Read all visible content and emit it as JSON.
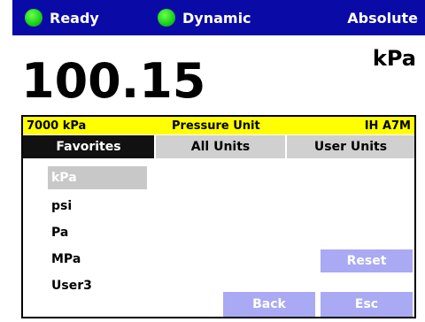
{
  "status_bar": {
    "ready_label": "Ready",
    "mode_label": "Dynamic",
    "reference_label": "Absolute",
    "led_color": "#1cd51c",
    "bar_color": "#0a0aa6"
  },
  "reading": {
    "value": "100.15",
    "unit": "kPa"
  },
  "panel": {
    "range_label": "7000 kPa",
    "title": "Pressure Unit",
    "sensor_label": "IH A7M",
    "header_color": "#ffff00"
  },
  "tabs": [
    {
      "label": "Favorites",
      "active": true
    },
    {
      "label": "All Units",
      "active": false
    },
    {
      "label": "User Units",
      "active": false
    }
  ],
  "units": [
    {
      "label": "kPa",
      "selected": true
    },
    {
      "label": "psi",
      "selected": false
    },
    {
      "label": "Pa",
      "selected": false
    },
    {
      "label": "MPa",
      "selected": false
    },
    {
      "label": "User3",
      "selected": false
    }
  ],
  "buttons": {
    "reset": "Reset",
    "back": "Back",
    "esc": "Esc",
    "button_color": "#a9aaf3"
  }
}
